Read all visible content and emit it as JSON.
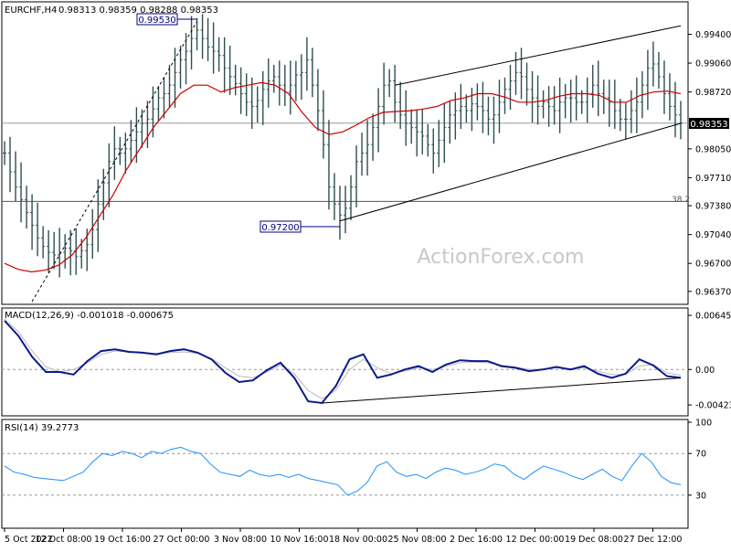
{
  "chart_data": [
    {
      "type": "candlestick",
      "symbol": "EURCHF,H4",
      "ohlc_header": "0.98313 0.98359 0.98288 0.98353",
      "watermark": "ActionForex.com",
      "ylim": [
        0.9625,
        0.9975
      ],
      "y_ticks": [
        "0.99400",
        "0.99060",
        "0.98720",
        "0.98050",
        "0.97710",
        "0.97380",
        "0.97040",
        "0.96700",
        "0.96370"
      ],
      "last_price": "0.98353",
      "x_ticks": [
        "5 Oct 2022",
        "12 Oct 08:00",
        "19 Oct 16:00",
        "27 Oct 00:00",
        "3 Nov 08:00",
        "10 Nov 16:00",
        "18 Nov 00:00",
        "25 Nov 08:00",
        "2 Dec 16:00",
        "12 Dec 00:00",
        "19 Dec 08:00",
        "27 Dec 12:00"
      ],
      "bar_count": 124,
      "close": [
        0.98,
        0.9778,
        0.976,
        0.9745,
        0.973,
        0.9715,
        0.97,
        0.969,
        0.9683,
        0.968,
        0.9683,
        0.9688,
        0.9685,
        0.9678,
        0.9685,
        0.9692,
        0.971,
        0.974,
        0.9765,
        0.979,
        0.9805,
        0.98,
        0.9805,
        0.9815,
        0.9825,
        0.9835,
        0.984,
        0.9852,
        0.9865,
        0.987,
        0.988,
        0.9895,
        0.991,
        0.992,
        0.9935,
        0.9945,
        0.9935,
        0.9925,
        0.992,
        0.9915,
        0.99,
        0.989,
        0.9882,
        0.987,
        0.986,
        0.9855,
        0.9862,
        0.9875,
        0.9885,
        0.989,
        0.988,
        0.9872,
        0.988,
        0.9892,
        0.9895,
        0.991,
        0.988,
        0.985,
        0.981,
        0.976,
        0.974,
        0.9727,
        0.9735,
        0.976,
        0.979,
        0.98,
        0.981,
        0.983,
        0.9855,
        0.988,
        0.9885,
        0.986,
        0.9845,
        0.9835,
        0.983,
        0.9825,
        0.982,
        0.981,
        0.98,
        0.9815,
        0.983,
        0.9845,
        0.985,
        0.9855,
        0.985,
        0.9858,
        0.9855,
        0.985,
        0.984,
        0.9845,
        0.986,
        0.9875,
        0.9885,
        0.9895,
        0.989,
        0.9875,
        0.9865,
        0.9855,
        0.986,
        0.9855,
        0.985,
        0.986,
        0.9865,
        0.9865,
        0.986,
        0.986,
        0.987,
        0.988,
        0.987,
        0.9865,
        0.986,
        0.985,
        0.984,
        0.984,
        0.985,
        0.986,
        0.988,
        0.99,
        0.9905,
        0.989,
        0.987,
        0.9855,
        0.9845,
        0.98353
      ],
      "moving_average": [
        0.967,
        0.9663,
        0.966,
        0.9662,
        0.9668,
        0.968,
        0.97,
        0.9725,
        0.975,
        0.978,
        0.9805,
        0.983,
        0.985,
        0.987,
        0.988,
        0.988,
        0.9872,
        0.9877,
        0.988,
        0.9883,
        0.988,
        0.987,
        0.9848,
        0.983,
        0.9822,
        0.9825,
        0.9833,
        0.9842,
        0.9848,
        0.9849,
        0.985,
        0.9852,
        0.9855,
        0.9862,
        0.9865,
        0.987,
        0.987,
        0.9866,
        0.986,
        0.986,
        0.9862,
        0.9867,
        0.987,
        0.987,
        0.9868,
        0.986,
        0.986,
        0.9868,
        0.9872,
        0.9873,
        0.987
      ],
      "annotations": [
        {
          "label": "0.99530",
          "price": 0.9953
        },
        {
          "label": "0.97200",
          "price": 0.972
        },
        {
          "label": "38.2",
          "price": 0.9743
        }
      ],
      "trendlines": [
        {
          "from": [
            0.972,
            "10 Nov"
          ],
          "to": [
            0.9835,
            "28 Dec"
          ],
          "kind": "channel support"
        },
        {
          "from": [
            0.988,
            "15 Nov"
          ],
          "to": [
            0.995,
            "28 Dec"
          ],
          "kind": "channel resistance"
        }
      ]
    },
    {
      "type": "line",
      "title": "MACD(12,26,9) -0.001018 -0.000675",
      "ylim": [
        -0.0052,
        0.007
      ],
      "y_ticks": [
        "0.00645",
        "0.00",
        "-0.00423"
      ],
      "macd": [
        0.0058,
        0.004,
        0.0015,
        -0.0003,
        -0.0003,
        -0.0006,
        0.001,
        0.0022,
        0.0024,
        0.0021,
        0.002,
        0.0018,
        0.0022,
        0.0024,
        0.002,
        0.0012,
        -0.0004,
        -0.0015,
        -0.0013,
        -0.0001,
        0.0008,
        -0.001,
        -0.0038,
        -0.004,
        -0.002,
        0.0012,
        0.0018,
        -0.001,
        -0.0006,
        0.0,
        0.0004,
        -0.0003,
        0.0006,
        0.0011,
        0.001,
        0.001,
        0.0004,
        0.0002,
        -0.0002,
        0.0,
        0.0003,
        0.0,
        0.0004,
        -0.0005,
        -0.001,
        -0.0005,
        0.0012,
        0.0005,
        -0.0008,
        -0.001
      ],
      "signal": [
        0.006,
        0.0045,
        0.0022,
        0.0003,
        -0.0003,
        0.0,
        0.0008,
        0.0018,
        0.0022,
        0.0021,
        0.002,
        0.0019,
        0.002,
        0.0021,
        0.0019,
        0.0013,
        0.0002,
        -0.0008,
        -0.001,
        -0.0003,
        0.0005,
        -0.0005,
        -0.0025,
        -0.0035,
        -0.0025,
        0.0,
        0.0012,
        0.0002,
        -0.0005,
        -0.0002,
        0.0002,
        0.0,
        0.0004,
        0.0008,
        0.0009,
        0.0008,
        0.0005,
        0.0003,
        0.0,
        0.0,
        0.0002,
        0.0001,
        0.0002,
        -0.0002,
        -0.0006,
        -0.0006,
        0.0004,
        0.0006,
        -0.0004,
        -0.0007
      ]
    },
    {
      "type": "line",
      "title": "RSI(14) 39.2773",
      "ylim": [
        0,
        100
      ],
      "y_ticks": [
        "100",
        "70",
        "30"
      ],
      "levels": [
        70,
        30
      ],
      "values": [
        58,
        52,
        50,
        47,
        46,
        45,
        44,
        48,
        52,
        62,
        70,
        68,
        72,
        70,
        66,
        72,
        70,
        74,
        76,
        72,
        70,
        60,
        52,
        50,
        48,
        54,
        50,
        48,
        50,
        47,
        50,
        46,
        44,
        42,
        40,
        30,
        34,
        42,
        58,
        62,
        52,
        48,
        50,
        46,
        52,
        56,
        54,
        50,
        52,
        55,
        60,
        58,
        50,
        45,
        52,
        58,
        55,
        52,
        48,
        45,
        50,
        55,
        48,
        44,
        58,
        70,
        62,
        48,
        42,
        40
      ]
    }
  ]
}
